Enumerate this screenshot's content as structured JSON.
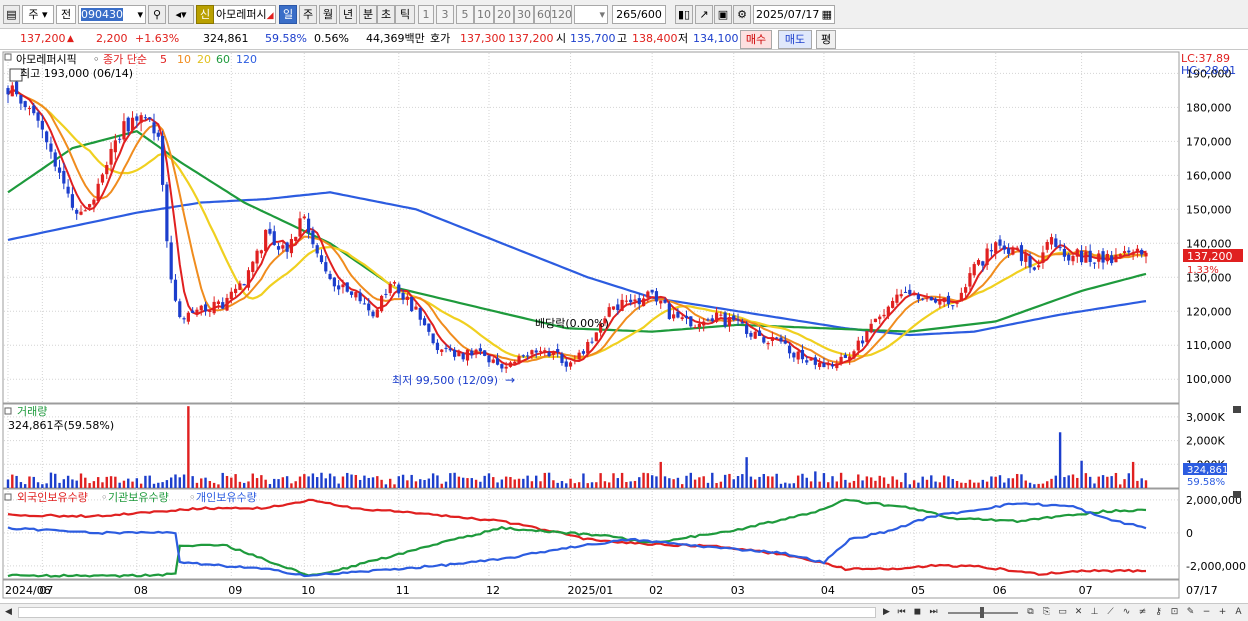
{
  "toolbar": {
    "period_selector": "주",
    "prev_label": "전",
    "stock_code": "090430",
    "credit_badge": "신",
    "stock_name": "아모레퍼시",
    "periods": [
      "일",
      "주",
      "월",
      "년",
      "분",
      "초",
      "틱"
    ],
    "active_period": "일",
    "intervals": [
      "1",
      "3",
      "5",
      "10",
      "20",
      "30",
      "60",
      "120"
    ],
    "count": "265",
    "count_max": "/600",
    "date": "2025/07/17"
  },
  "quote": {
    "price": "137,200",
    "arrow": "▲",
    "change": "2,200",
    "change_pct": "+1.63%",
    "volume": "324,861",
    "volume_ratio": "59.58%",
    "turnover_pct": "0.56%",
    "amount": "44,369백만",
    "ask_label": "호가",
    "ask": "137,300",
    "bid": "137,200",
    "open_label": "시",
    "open": "135,700",
    "high_label": "고",
    "high": "138,400",
    "low_label": "저",
    "low": "134,100",
    "buy_label": "매수",
    "sell_label": "매도",
    "avg_label": "평"
  },
  "bottom": {
    "buttons": [
      "◀",
      "▶",
      "⏮",
      "◼",
      "⏭"
    ],
    "zoom_out": "−",
    "zoom_in": "+",
    "text_tool": "A"
  },
  "chart_data": [
    {
      "type": "candlestick",
      "title": "아모레퍼시픽",
      "legend": {
        "main": "종가 단순",
        "ma_labels": [
          "5",
          "10",
          "20",
          "60",
          "120"
        ],
        "ma_colors": [
          "#e02020",
          "#f08c1e",
          "#f0d020",
          "#1e9a3c",
          "#2c5ce0"
        ]
      },
      "indicator": {
        "lc": "LC:37.89",
        "hc": "HC:-28.91"
      },
      "ylim": [
        93000,
        196000
      ],
      "y_ticks": [
        100000,
        110000,
        120000,
        130000,
        140000,
        150000,
        160000,
        170000,
        180000,
        190000
      ],
      "y_tick_labels": [
        "100,000",
        "110,000",
        "120,000",
        "130,000",
        "140,000",
        "150,000",
        "160,000",
        "170,000",
        "180,000",
        "190,000"
      ],
      "x_ticks": [
        {
          "i": 0,
          "label": "2024/06"
        },
        {
          "i": 8,
          "label": "07"
        },
        {
          "i": 30,
          "label": "08"
        },
        {
          "i": 52,
          "label": "09"
        },
        {
          "i": 69,
          "label": "10"
        },
        {
          "i": 91,
          "label": "11"
        },
        {
          "i": 112,
          "label": "12"
        },
        {
          "i": 131,
          "label": "2025/01"
        },
        {
          "i": 150,
          "label": "02"
        },
        {
          "i": 169,
          "label": "03"
        },
        {
          "i": 190,
          "label": "04"
        },
        {
          "i": 211,
          "label": "05"
        },
        {
          "i": 230,
          "label": "06"
        },
        {
          "i": 250,
          "label": "07"
        },
        {
          "i": 265,
          "label": "07/17"
        }
      ],
      "anchors_close": [
        [
          0,
          186000
        ],
        [
          5,
          180000
        ],
        [
          10,
          168000
        ],
        [
          15,
          150000
        ],
        [
          20,
          152000
        ],
        [
          25,
          172000
        ],
        [
          32,
          178000
        ],
        [
          35,
          170000
        ],
        [
          38,
          128000
        ],
        [
          40,
          118000
        ],
        [
          45,
          121000
        ],
        [
          50,
          122000
        ],
        [
          55,
          128000
        ],
        [
          60,
          142000
        ],
        [
          65,
          138000
        ],
        [
          69,
          150000
        ],
        [
          71,
          138000
        ],
        [
          75,
          130000
        ],
        [
          80,
          125000
        ],
        [
          85,
          120000
        ],
        [
          90,
          128000
        ],
        [
          95,
          120000
        ],
        [
          100,
          110000
        ],
        [
          105,
          107000
        ],
        [
          110,
          108000
        ],
        [
          115,
          103000
        ],
        [
          118,
          106000
        ],
        [
          125,
          109000
        ],
        [
          131,
          104000
        ],
        [
          135,
          110000
        ],
        [
          140,
          120000
        ],
        [
          145,
          123000
        ],
        [
          150,
          125000
        ],
        [
          155,
          118000
        ],
        [
          160,
          117000
        ],
        [
          165,
          118000
        ],
        [
          170,
          116000
        ],
        [
          175,
          113000
        ],
        [
          180,
          110000
        ],
        [
          185,
          106000
        ],
        [
          190,
          103000
        ],
        [
          195,
          106000
        ],
        [
          200,
          113000
        ],
        [
          205,
          122000
        ],
        [
          210,
          126000
        ],
        [
          215,
          123000
        ],
        [
          220,
          122000
        ],
        [
          225,
          132000
        ],
        [
          230,
          140000
        ],
        [
          235,
          137000
        ],
        [
          240,
          133000
        ],
        [
          243,
          143000
        ],
        [
          246,
          137000
        ],
        [
          250,
          136000
        ],
        [
          255,
          135000
        ],
        [
          260,
          138000
        ],
        [
          265,
          137200
        ]
      ],
      "anchors_ma60": [
        [
          0,
          155000
        ],
        [
          15,
          168000
        ],
        [
          30,
          173000
        ],
        [
          40,
          164000
        ],
        [
          55,
          152000
        ],
        [
          75,
          140000
        ],
        [
          90,
          127000
        ],
        [
          110,
          121000
        ],
        [
          130,
          115000
        ],
        [
          150,
          114000
        ],
        [
          170,
          116000
        ],
        [
          190,
          115000
        ],
        [
          210,
          114000
        ],
        [
          230,
          117000
        ],
        [
          250,
          126000
        ],
        [
          265,
          131000
        ]
      ],
      "anchors_ma120": [
        [
          0,
          141000
        ],
        [
          30,
          149000
        ],
        [
          45,
          152000
        ],
        [
          60,
          153000
        ],
        [
          75,
          155000
        ],
        [
          95,
          150000
        ],
        [
          115,
          140000
        ],
        [
          135,
          130000
        ],
        [
          150,
          124000
        ],
        [
          165,
          121000
        ],
        [
          180,
          118000
        ],
        [
          195,
          115000
        ],
        [
          210,
          113000
        ],
        [
          225,
          114000
        ],
        [
          245,
          119000
        ],
        [
          265,
          123000
        ]
      ],
      "annotations": {
        "high": "최고 193,000 (06/14)",
        "low": "최저 99,500 (12/09)",
        "dividend": "배당락(0.00%)",
        "price_label": "137,200",
        "price_pct": "1.33%"
      }
    },
    {
      "type": "bar",
      "title": "거래량",
      "current": "324,861주(59.58%)",
      "ylim": [
        0,
        3500000
      ],
      "y_ticks": [
        1000000,
        2000000,
        3000000
      ],
      "y_tick_labels": [
        "1,000K",
        "2,000K",
        "3,000K"
      ],
      "current_label": "324,861",
      "current_pct": "59.58%",
      "spikes": [
        [
          42,
          3450000
        ],
        [
          152,
          1100000
        ],
        [
          172,
          1300000
        ],
        [
          188,
          700000
        ],
        [
          245,
          2350000
        ],
        [
          250,
          1150000
        ],
        [
          262,
          1100000
        ]
      ]
    },
    {
      "type": "line",
      "series": [
        {
          "name": "외국인보유수량",
          "color": "#e02020",
          "anchors": [
            [
              0,
              1100000
            ],
            [
              20,
              1000000
            ],
            [
              30,
              1200000
            ],
            [
              45,
              1500000
            ],
            [
              60,
              1500000
            ],
            [
              70,
              2000000
            ],
            [
              80,
              1500000
            ],
            [
              95,
              1200000
            ],
            [
              115,
              700000
            ],
            [
              125,
              200000
            ],
            [
              135,
              -400000
            ],
            [
              150,
              -700000
            ],
            [
              165,
              -800000
            ],
            [
              180,
              -1300000
            ],
            [
              190,
              -1800000
            ],
            [
              195,
              -2200000
            ],
            [
              205,
              -2200000
            ],
            [
              215,
              -2000000
            ],
            [
              225,
              -2000000
            ],
            [
              240,
              -2500000
            ],
            [
              250,
              -2300000
            ],
            [
              265,
              -2300000
            ]
          ]
        },
        {
          "name": "기관보유수량",
          "color": "#1e9a3c",
          "anchors": [
            [
              0,
              -2600000
            ],
            [
              30,
              -2600000
            ],
            [
              39,
              -2500000
            ],
            [
              40,
              -800000
            ],
            [
              50,
              -700000
            ],
            [
              70,
              -2600000
            ],
            [
              75,
              -2400000
            ],
            [
              95,
              -1000000
            ],
            [
              115,
              300000
            ],
            [
              130,
              0
            ],
            [
              140,
              -200000
            ],
            [
              150,
              -600000
            ],
            [
              170,
              200000
            ],
            [
              190,
              1400000
            ],
            [
              195,
              2000000
            ],
            [
              210,
              1500000
            ],
            [
              220,
              900000
            ],
            [
              235,
              700000
            ],
            [
              245,
              1000000
            ],
            [
              255,
              1300000
            ],
            [
              265,
              1400000
            ]
          ]
        },
        {
          "name": "개인보유수량",
          "color": "#2c5ce0",
          "anchors": [
            [
              0,
              300000
            ],
            [
              20,
              0
            ],
            [
              39,
              0
            ],
            [
              40,
              -1800000
            ],
            [
              50,
              -2000000
            ],
            [
              60,
              -2200000
            ],
            [
              70,
              -2600000
            ],
            [
              85,
              -2300000
            ],
            [
              100,
              -2000000
            ],
            [
              115,
              -1600000
            ],
            [
              130,
              -900000
            ],
            [
              145,
              -400000
            ],
            [
              165,
              -900000
            ],
            [
              180,
              -1200000
            ],
            [
              190,
              -1800000
            ],
            [
              196,
              -400000
            ],
            [
              205,
              100000
            ],
            [
              215,
              1000000
            ],
            [
              228,
              1500000
            ],
            [
              235,
              1800000
            ],
            [
              248,
              1600000
            ],
            [
              255,
              900000
            ],
            [
              265,
              300000
            ]
          ]
        }
      ],
      "ylim": [
        -2800000,
        2600000
      ],
      "y_ticks": [
        2000000,
        0,
        -2000000
      ],
      "y_tick_labels": [
        "2,000,000",
        "0",
        "-2,000,000"
      ]
    }
  ]
}
